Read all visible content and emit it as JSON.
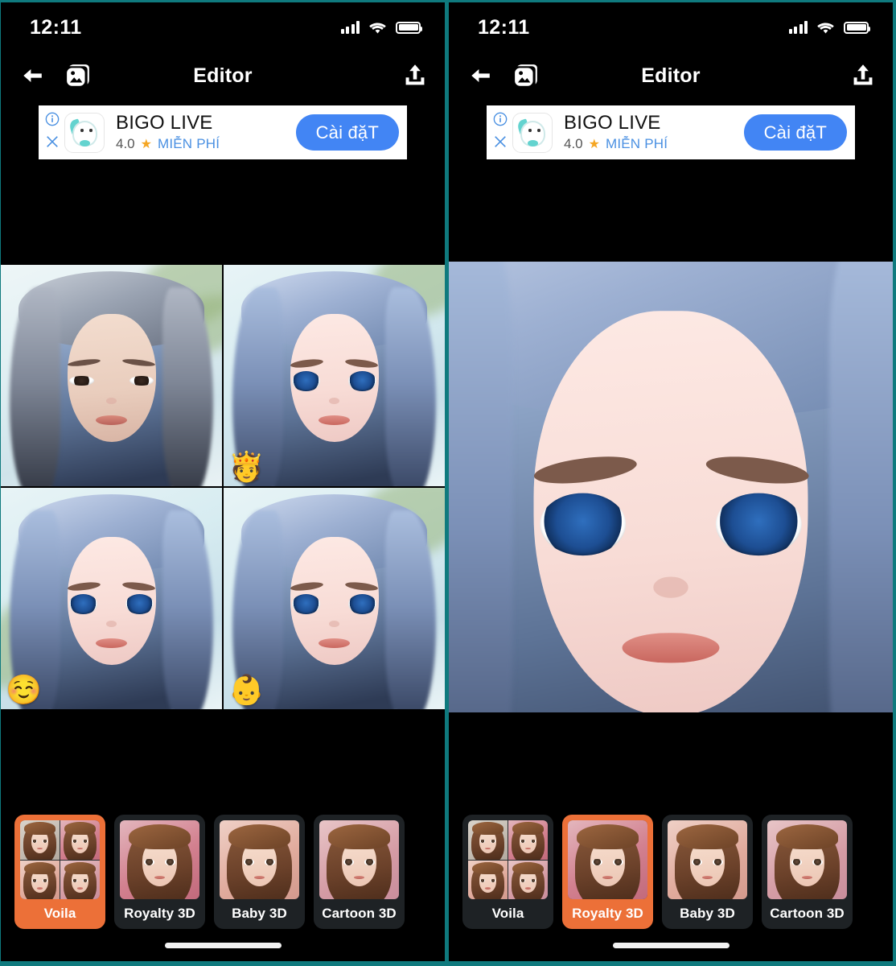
{
  "theme": {
    "divider_color": "#0f7a7e",
    "accent_selected": "#ec7038",
    "card_bg": "#1e2225",
    "panel_bg": "#000000",
    "ad_cta_color": "#4285f4",
    "ad_link_color": "#4a90e2",
    "star_color": "#f5a623"
  },
  "panels": [
    {
      "id": "panel-left",
      "status_bar": {
        "time": "12:11",
        "cellular_icon": "cellular-signal-icon",
        "wifi_icon": "wifi-icon",
        "battery_icon": "battery-icon"
      },
      "nav": {
        "back_icon": "back-arrow-icon",
        "gallery_icon": "photo-stack-icon",
        "title": "Editor",
        "share_icon": "share-upload-icon"
      },
      "ad": {
        "info_icon": "info-icon",
        "close_icon": "close-icon",
        "app_icon": "bigo-live-app-icon",
        "title": "BIGO LIVE",
        "rating": "4.0",
        "star": "★",
        "price": "MIỄN PHÍ",
        "cta_label": "Cài đặT"
      },
      "result": {
        "mode": "grid",
        "cells": [
          {
            "name": "original-photo",
            "badge": "",
            "variant": "real"
          },
          {
            "name": "royalty-3d-result",
            "badge": "🫅",
            "variant": "toon"
          },
          {
            "name": "cartoon-3d-result",
            "badge": "☺️",
            "variant": "toon"
          },
          {
            "name": "baby-3d-result",
            "badge": "👶",
            "variant": "toon"
          }
        ]
      },
      "tray": {
        "styles": [
          {
            "label": "Voila",
            "selected": true,
            "thumb": "quad"
          },
          {
            "label": "Royalty 3D",
            "selected": false,
            "thumb": "pink"
          },
          {
            "label": "Baby 3D",
            "selected": false,
            "thumb": "peach"
          },
          {
            "label": "Cartoon 3D",
            "selected": false,
            "thumb": "rose"
          }
        ]
      },
      "home_indicator": "home-indicator"
    },
    {
      "id": "panel-right",
      "status_bar": {
        "time": "12:11",
        "cellular_icon": "cellular-signal-icon",
        "wifi_icon": "wifi-icon",
        "battery_icon": "battery-icon"
      },
      "nav": {
        "back_icon": "back-arrow-icon",
        "gallery_icon": "photo-stack-icon",
        "title": "Editor",
        "share_icon": "share-upload-icon"
      },
      "ad": {
        "info_icon": "info-icon",
        "close_icon": "close-icon",
        "app_icon": "bigo-live-app-icon",
        "title": "BIGO LIVE",
        "rating": "4.0",
        "star": "★",
        "price": "MIỄN PHÍ",
        "cta_label": "Cài đặT"
      },
      "result": {
        "mode": "single",
        "cells": [
          {
            "name": "royalty-3d-preview",
            "badge": "",
            "variant": "toon"
          }
        ]
      },
      "tray": {
        "styles": [
          {
            "label": "Voila",
            "selected": false,
            "thumb": "quad"
          },
          {
            "label": "Royalty 3D",
            "selected": true,
            "thumb": "pink"
          },
          {
            "label": "Baby 3D",
            "selected": false,
            "thumb": "peach"
          },
          {
            "label": "Cartoon 3D",
            "selected": false,
            "thumb": "rose"
          }
        ]
      },
      "home_indicator": "home-indicator"
    }
  ]
}
